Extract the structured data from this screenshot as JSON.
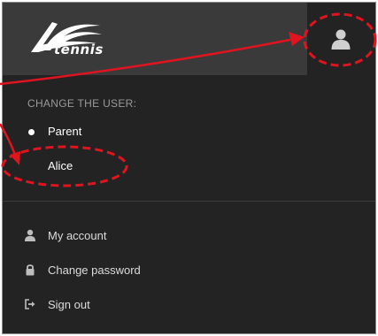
{
  "header": {
    "logo_text": "tennis",
    "user_button_icon": "user-icon"
  },
  "user_switcher": {
    "section_label": "CHANGE THE USER:",
    "users": [
      {
        "label": "Parent",
        "selected": true
      },
      {
        "label": "Alice",
        "selected": false
      }
    ]
  },
  "menu": {
    "items": [
      {
        "label": "My account",
        "icon": "user-icon"
      },
      {
        "label": "Change password",
        "icon": "lock-icon"
      },
      {
        "label": "Sign out",
        "icon": "sign-out-icon"
      }
    ]
  },
  "colors": {
    "background": "#232323",
    "logo_panel": "#3a3a3a",
    "annotation": "#e0141e"
  }
}
